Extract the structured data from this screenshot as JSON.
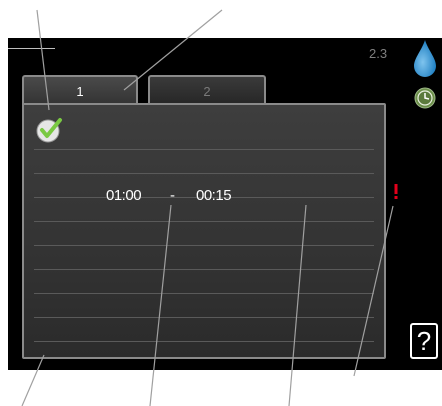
{
  "header": {
    "menu_number": "2.3",
    "icons": [
      "water-drop-icon",
      "clock-icon"
    ]
  },
  "tabs": [
    {
      "label": "1",
      "active": true
    },
    {
      "label": "2",
      "active": false
    }
  ],
  "schedule": {
    "enabled_icon": "checkmark-icon",
    "start_time": "01:00",
    "separator": "-",
    "end_time": "00:15"
  },
  "conflict_icon": "exclamation-icon",
  "help": {
    "label": "?"
  },
  "colors": {
    "background": "#000000",
    "panel": "#353535",
    "check": "#7ac943",
    "warning": "#e3001b"
  }
}
